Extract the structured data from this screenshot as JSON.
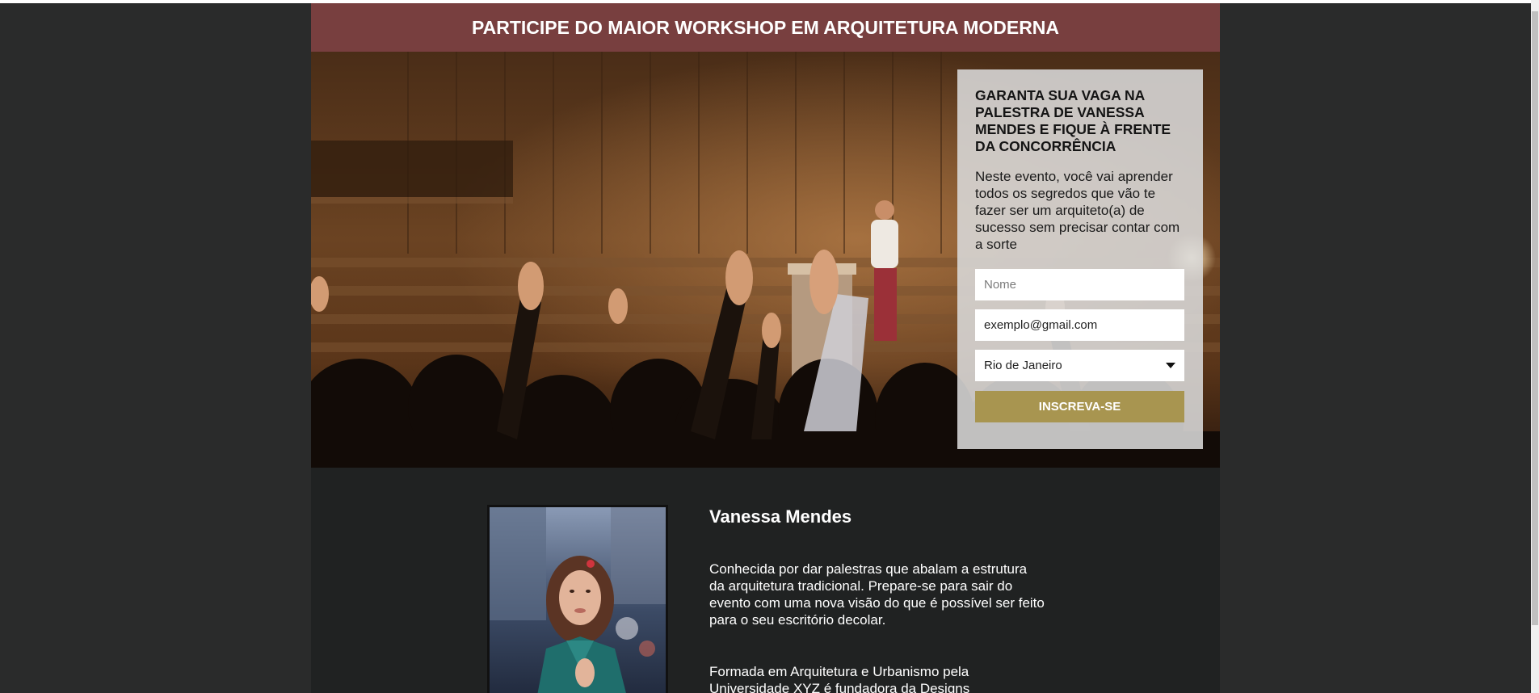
{
  "banner": {
    "title": "PARTICIPE DO MAIOR WORKSHOP EM ARQUITETURA MODERNA"
  },
  "hero": {
    "image": "conference-audience-raising-hands"
  },
  "signup_form": {
    "heading": "GARANTA SUA VAGA NA PALESTRA DE VANESSA MENDES E FIQUE À FRENTE DA CONCORRÊNCIA",
    "description": "Neste evento, você vai aprender todos os segredos que vão te fazer ser um arquiteto(a) de sucesso sem precisar contar com a sorte",
    "name_placeholder": "Nome",
    "email_value": "exemplo@gmail.com",
    "city_selected": "Rio de Janeiro",
    "submit_label": "INSCREVA-SE"
  },
  "speaker": {
    "name": "Vanessa Mendes",
    "bio_1": "Conhecida por dar palestras que abalam a estrutura da arquitetura tradicional. Prepare-se para sair do evento com uma nova visão do que é possível ser feito para o seu escritório decolar.",
    "bio_2": "Formada em Arquitetura e Urbanismo pela Universidade XYZ é fundadora da Designs",
    "photo": "speaker-portrait"
  },
  "colors": {
    "banner": "#783f3f",
    "button": "#a89550",
    "page_bg": "#202222",
    "outer_bg": "#2a2b2b"
  }
}
